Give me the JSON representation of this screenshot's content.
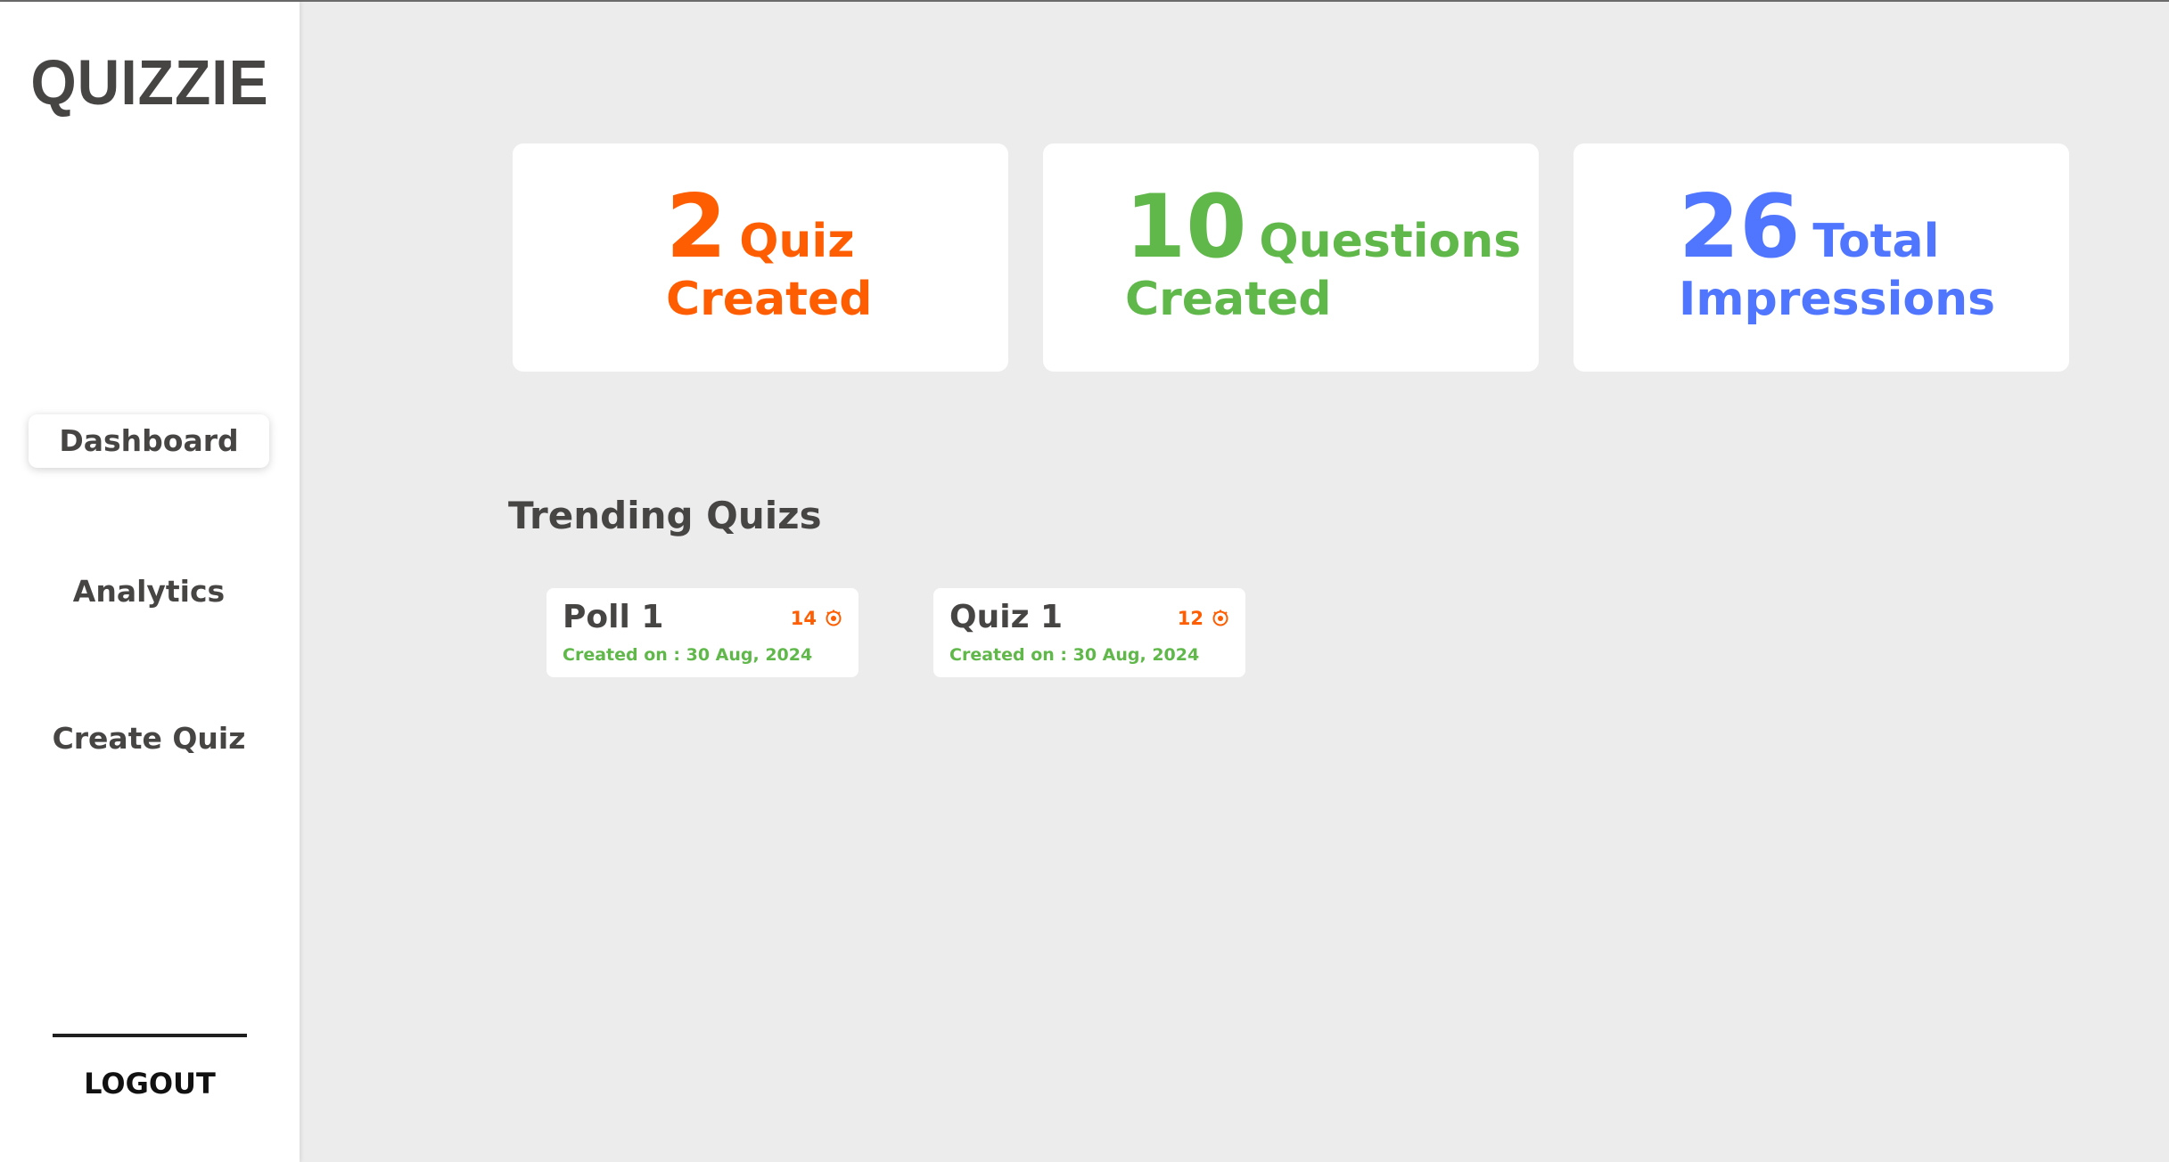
{
  "sidebar": {
    "logo": "QUIZZIE",
    "nav": [
      {
        "label": "Dashboard",
        "active": true
      },
      {
        "label": "Analytics",
        "active": false
      },
      {
        "label": "Create Quiz",
        "active": false
      }
    ],
    "logout_label": "LOGOUT"
  },
  "stats": [
    {
      "value": "2",
      "word1": "Quiz",
      "word2": "Created",
      "color": "#ff5d01"
    },
    {
      "value": "10",
      "word1": "Questions",
      "word2": "Created",
      "color": "#60b84b"
    },
    {
      "value": "26",
      "word1": "Total",
      "word2": "Impressions",
      "color": "#5076ff"
    }
  ],
  "trending": {
    "title": "Trending Quizs",
    "quizzes": [
      {
        "name": "Poll 1",
        "impressions": "14",
        "created": "Created on : 30 Aug, 2024",
        "icon": "eye-icon"
      },
      {
        "name": "Quiz 1",
        "impressions": "12",
        "created": "Created on : 30 Aug, 2024",
        "icon": "eye-icon"
      }
    ]
  }
}
